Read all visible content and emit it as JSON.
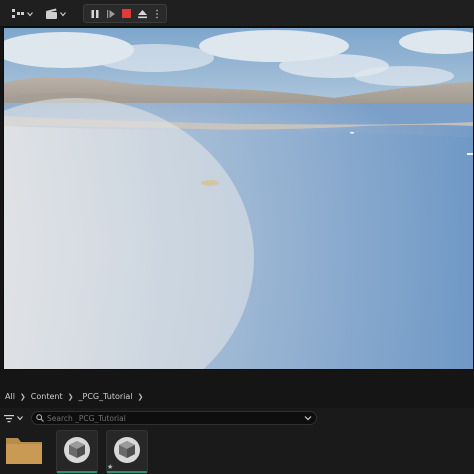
{
  "toolbar": {
    "icons": [
      "selection-mode-icon",
      "cinematics-icon",
      "pause-icon",
      "frame-skip-icon",
      "stop-icon",
      "eject-icon",
      "more-options-icon"
    ],
    "stop_color": "#e23a3a"
  },
  "viewport": {
    "sky_color": "#8fb0cf",
    "water_color": "#7fa3cc",
    "shore_color": "#cbc1b7"
  },
  "content_browser": {
    "breadcrumb": [
      "All",
      "Content",
      "_PCG_Tutorial"
    ],
    "search": {
      "placeholder": "Search _PCG_Tutorial",
      "value": ""
    },
    "assets": [
      {
        "kind": "folder",
        "icon": "folder-icon"
      },
      {
        "kind": "static-mesh",
        "icon": "cube-icon"
      },
      {
        "kind": "static-mesh",
        "icon": "cube-icon",
        "favorite": true
      }
    ],
    "accent_color": "#2f8f6c"
  }
}
